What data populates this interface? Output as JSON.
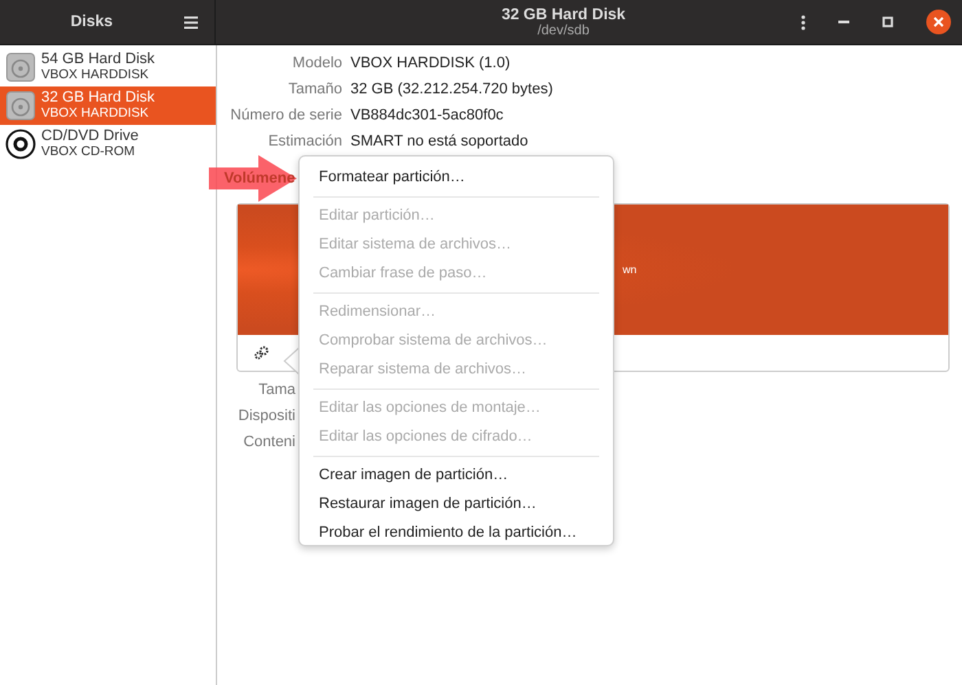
{
  "header": {
    "app_title": "Disks",
    "title": "32 GB Hard Disk",
    "subtitle": "/dev/sdb"
  },
  "sidebar": {
    "items": [
      {
        "name": "54 GB Hard Disk",
        "model": "VBOX HARDDISK",
        "kind": "hdd",
        "selected": false
      },
      {
        "name": "32 GB Hard Disk",
        "model": "VBOX HARDDISK",
        "kind": "hdd",
        "selected": true
      },
      {
        "name": "CD/DVD Drive",
        "model": "VBOX CD-ROM",
        "kind": "optical",
        "selected": false
      }
    ]
  },
  "disk_info": [
    {
      "label": "Modelo",
      "value": "VBOX HARDDISK (1.0)"
    },
    {
      "label": "Tamaño",
      "value": "32 GB (32.212.254.720 bytes)"
    },
    {
      "label": "Número de serie",
      "value": "VB884dc301-5ac80f0c"
    },
    {
      "label": "Estimación",
      "value": "SMART no está soportado"
    }
  ],
  "volumes": {
    "title": "Volúmene",
    "partition_label": "wn"
  },
  "partition_info": [
    {
      "label": "Tama"
    },
    {
      "label": "Dispositi"
    },
    {
      "label": "Conteni"
    }
  ],
  "context_menu": {
    "groups": [
      [
        {
          "label": "Formatear partición…",
          "disabled": false
        }
      ],
      [
        {
          "label": "Editar partición…",
          "disabled": true
        },
        {
          "label": "Editar sistema de archivos…",
          "disabled": true
        },
        {
          "label": "Cambiar frase de paso…",
          "disabled": true
        }
      ],
      [
        {
          "label": "Redimensionar…",
          "disabled": true
        },
        {
          "label": "Comprobar sistema de archivos…",
          "disabled": true
        },
        {
          "label": "Reparar sistema de archivos…",
          "disabled": true
        }
      ],
      [
        {
          "label": "Editar las opciones de montaje…",
          "disabled": true
        },
        {
          "label": "Editar las opciones de cifrado…",
          "disabled": true
        }
      ],
      [
        {
          "label": "Crear imagen de partición…",
          "disabled": false
        },
        {
          "label": "Restaurar imagen de partición…",
          "disabled": false
        },
        {
          "label": "Probar el rendimiento de la partición…",
          "disabled": false
        }
      ]
    ]
  }
}
